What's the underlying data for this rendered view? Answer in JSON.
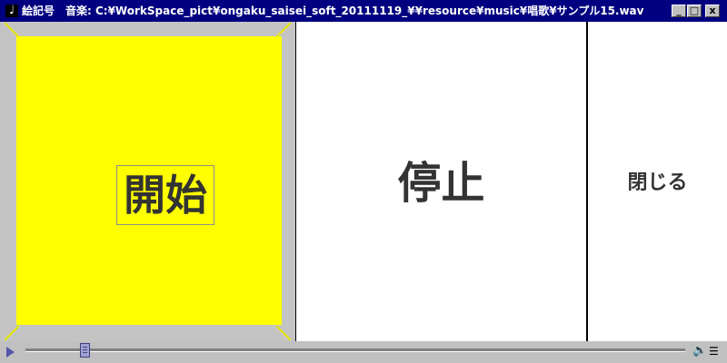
{
  "window": {
    "title": "絵記号　音楽: C:¥WorkSpace_pict¥ongaku_saisei_soft_20111119_¥¥resource¥music¥唱歌¥サンプル15.wav",
    "icons": {
      "app": "music-note-icon",
      "minimize": "minimize-icon",
      "maximize": "maximize-icon",
      "close": "close-icon"
    }
  },
  "controls": {
    "start_label": "開始",
    "stop_label": "停止",
    "close_label": "閉じる",
    "start_color": "#ffff00"
  },
  "player": {
    "icons": {
      "play": "play-icon",
      "volume": "volume-icon",
      "menu": "menu-icon"
    },
    "position_fraction": 0.09
  }
}
